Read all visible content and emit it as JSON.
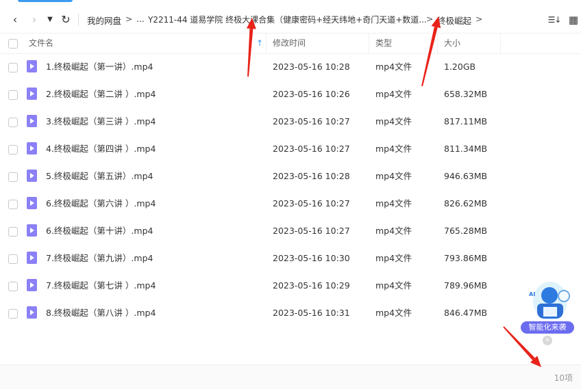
{
  "toolbar": {
    "back_icon": "‹",
    "forward_icon": "›",
    "dropdown_icon": "▼",
    "refresh_icon": "↻",
    "sort_icon": "☰↓",
    "grid_icon": "▦"
  },
  "breadcrumb": {
    "root": "我的网盘",
    "separator": ">",
    "ellipsis": "...",
    "folder": "Y2211-44 道易学院 终极大课合集（健康密码+经天纬地+奇门天道+数道...",
    "current": "终极崛起"
  },
  "table": {
    "headers": {
      "name": "文件名",
      "modified": "修改时间",
      "type": "类型",
      "size": "大小"
    },
    "sort_indicator": "↑",
    "rows": [
      {
        "name": "1.终极崛起（第一讲）.mp4",
        "modified": "2023-05-16 10:28",
        "type": "mp4文件",
        "size": "1.20GB"
      },
      {
        "name": "2.终极崛起（第二讲 ）.mp4",
        "modified": "2023-05-16 10:26",
        "type": "mp4文件",
        "size": "658.32MB"
      },
      {
        "name": "3.终极崛起（第三讲 ）.mp4",
        "modified": "2023-05-16 10:27",
        "type": "mp4文件",
        "size": "817.11MB"
      },
      {
        "name": "4.终极崛起（第四讲 ）.mp4",
        "modified": "2023-05-16 10:27",
        "type": "mp4文件",
        "size": "811.34MB"
      },
      {
        "name": "5.终极崛起（第五讲）.mp4",
        "modified": "2023-05-16 10:28",
        "type": "mp4文件",
        "size": "946.63MB"
      },
      {
        "name": "6.终极崛起（第六讲 ）.mp4",
        "modified": "2023-05-16 10:27",
        "type": "mp4文件",
        "size": "826.62MB"
      },
      {
        "name": "6.终极崛起（第十讲）.mp4",
        "modified": "2023-05-16 10:27",
        "type": "mp4文件",
        "size": "765.28MB"
      },
      {
        "name": "7.终极崛起（第九讲）.mp4",
        "modified": "2023-05-16 10:30",
        "type": "mp4文件",
        "size": "793.86MB"
      },
      {
        "name": "7.终极崛起（第七讲 ）.mp4",
        "modified": "2023-05-16 10:29",
        "type": "mp4文件",
        "size": "789.96MB"
      },
      {
        "name": "8.终极崛起（第八讲 ）.mp4",
        "modified": "2023-05-16 10:31",
        "type": "mp4文件",
        "size": "846.47MB"
      }
    ]
  },
  "footer": {
    "count": "10项"
  },
  "widget": {
    "label": "智能化来袭",
    "badge": "AI",
    "close_icon": "×"
  },
  "colors": {
    "accent": "#3b9bf0",
    "file_icon": "#8b80f5",
    "annotation_arrow": "#e8231a",
    "widget_pill": "#6c6cf0"
  }
}
